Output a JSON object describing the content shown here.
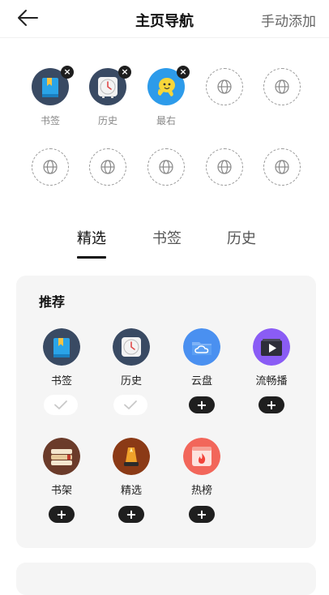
{
  "header": {
    "title": "主页导航",
    "manual_add": "手动添加"
  },
  "slots": [
    {
      "label": "书签",
      "icon": "bookmark-icon",
      "removable": true
    },
    {
      "label": "历史",
      "icon": "clock-icon",
      "removable": true
    },
    {
      "label": "最右",
      "icon": "zuiyou-icon",
      "removable": true
    }
  ],
  "tabs": [
    "精选",
    "书签",
    "历史"
  ],
  "active_tab": "精选",
  "recommend": {
    "title": "推荐",
    "items": [
      {
        "label": "书签",
        "icon": "bookmark-icon",
        "state": "added"
      },
      {
        "label": "历史",
        "icon": "clock-icon",
        "state": "added"
      },
      {
        "label": "云盘",
        "icon": "cloud-folder-icon",
        "state": "add"
      },
      {
        "label": "流畅播",
        "icon": "video-play-icon",
        "state": "add"
      },
      {
        "label": "书架",
        "icon": "bookshelf-icon",
        "state": "add"
      },
      {
        "label": "精选",
        "icon": "lamp-icon",
        "state": "add"
      },
      {
        "label": "热榜",
        "icon": "fire-icon",
        "state": "add"
      }
    ]
  },
  "symbols": {
    "add": "+",
    "remove": "×"
  }
}
